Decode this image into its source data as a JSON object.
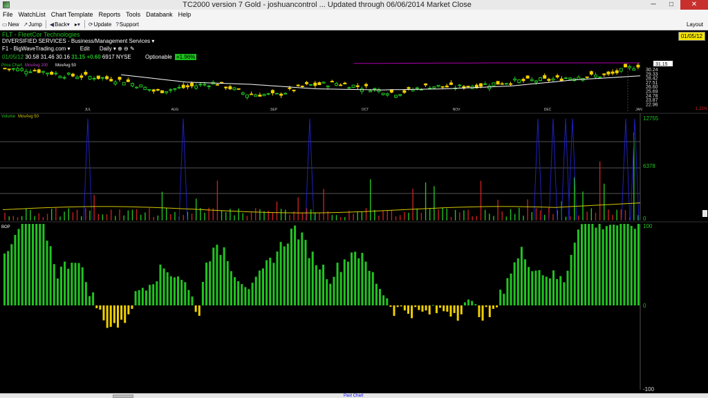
{
  "window": {
    "title": "TC2000 version 7 Gold - joshuancontrol ... Updated through 06/06/2014 Market Close",
    "minimize": "─",
    "maximize": "□",
    "close": "✕"
  },
  "menu": [
    "File",
    "WatchList",
    "Chart Template",
    "Reports",
    "Tools",
    "Databank",
    "Help"
  ],
  "toolbar": {
    "new_label": "New",
    "jump_label": "Jump",
    "back_label": "Back",
    "forward_label": "▸",
    "update_label": "Update",
    "support_label": "Support",
    "layout_label": "Layout"
  },
  "header": {
    "symbol": "FLT - FleetCor Technologies",
    "sector": "DIVERSIFIED SERVICES - Business/Management Services ▾",
    "watchlist": "F1 - BigWaveTrading.com ▾",
    "edit": "Edit",
    "period": "Daily ▾",
    "date": "01/05/12",
    "open": "30.58",
    "high": "31.46",
    "low": "30.16",
    "close": "31.15",
    "change": "+0.60",
    "volume": "6917",
    "exchange": "NYSE",
    "optionable": "Optionable",
    "pct_change": "+1.96%",
    "current_date_box": "01/05/12"
  },
  "panes": {
    "price_legend": [
      "Price Chart",
      "MovAvg 200",
      "MovAvg 50"
    ],
    "volume_legend": [
      "Volume",
      "MovAvg 50"
    ],
    "bop_legend": "BOP"
  },
  "axis": {
    "months": [
      "JUL",
      "AUG",
      "SEP",
      "OCT",
      "NOV",
      "DEC",
      "JAN"
    ],
    "price_last": "31.15",
    "price_ticks": [
      "30.24",
      "29.33",
      "28.42",
      "27.51",
      "26.60",
      "25.69",
      "24.78",
      "23.87",
      "22.96"
    ],
    "price_pct": "1.22%",
    "volume_ticks": [
      "12755",
      "6378",
      "0"
    ],
    "bop_ticks": [
      "100",
      "0",
      "-100"
    ]
  },
  "scrollbar": {
    "label": "Past Chart"
  },
  "colors": {
    "up": "#22c322",
    "down": "#f0d000",
    "ma200": "#b000b0",
    "ma50": "#ffffff",
    "volume_ma": "#d8c800",
    "volume_spike": "#2020c0"
  },
  "chart_data": [
    {
      "type": "line",
      "title": "FLT - FleetCor Technologies",
      "series": [
        {
          "name": "MovAvg 200",
          "values": [
            31.5,
            31.6,
            31.6
          ]
        },
        {
          "name": "MovAvg 50",
          "values": [
            29.5,
            28.2,
            27.8,
            27.0,
            26.8,
            27.0,
            27.5,
            28.6,
            29.3
          ]
        },
        {
          "name": "Price Chart",
          "values": [
            30.6,
            30.3,
            29.4,
            29.1,
            28.4,
            26.5,
            27.3,
            28.1,
            26.1,
            25.9,
            27.6,
            28.0,
            27.2,
            26.2,
            27.5,
            27.3,
            27.8,
            28.4,
            28.6,
            29.2,
            29.4,
            31.2
          ]
        }
      ]
    },
    {
      "type": "bar",
      "title": "Volume",
      "ylim": [
        0,
        12755
      ]
    },
    {
      "type": "bar",
      "title": "BOP",
      "ylim": [
        -100,
        100
      ]
    }
  ]
}
